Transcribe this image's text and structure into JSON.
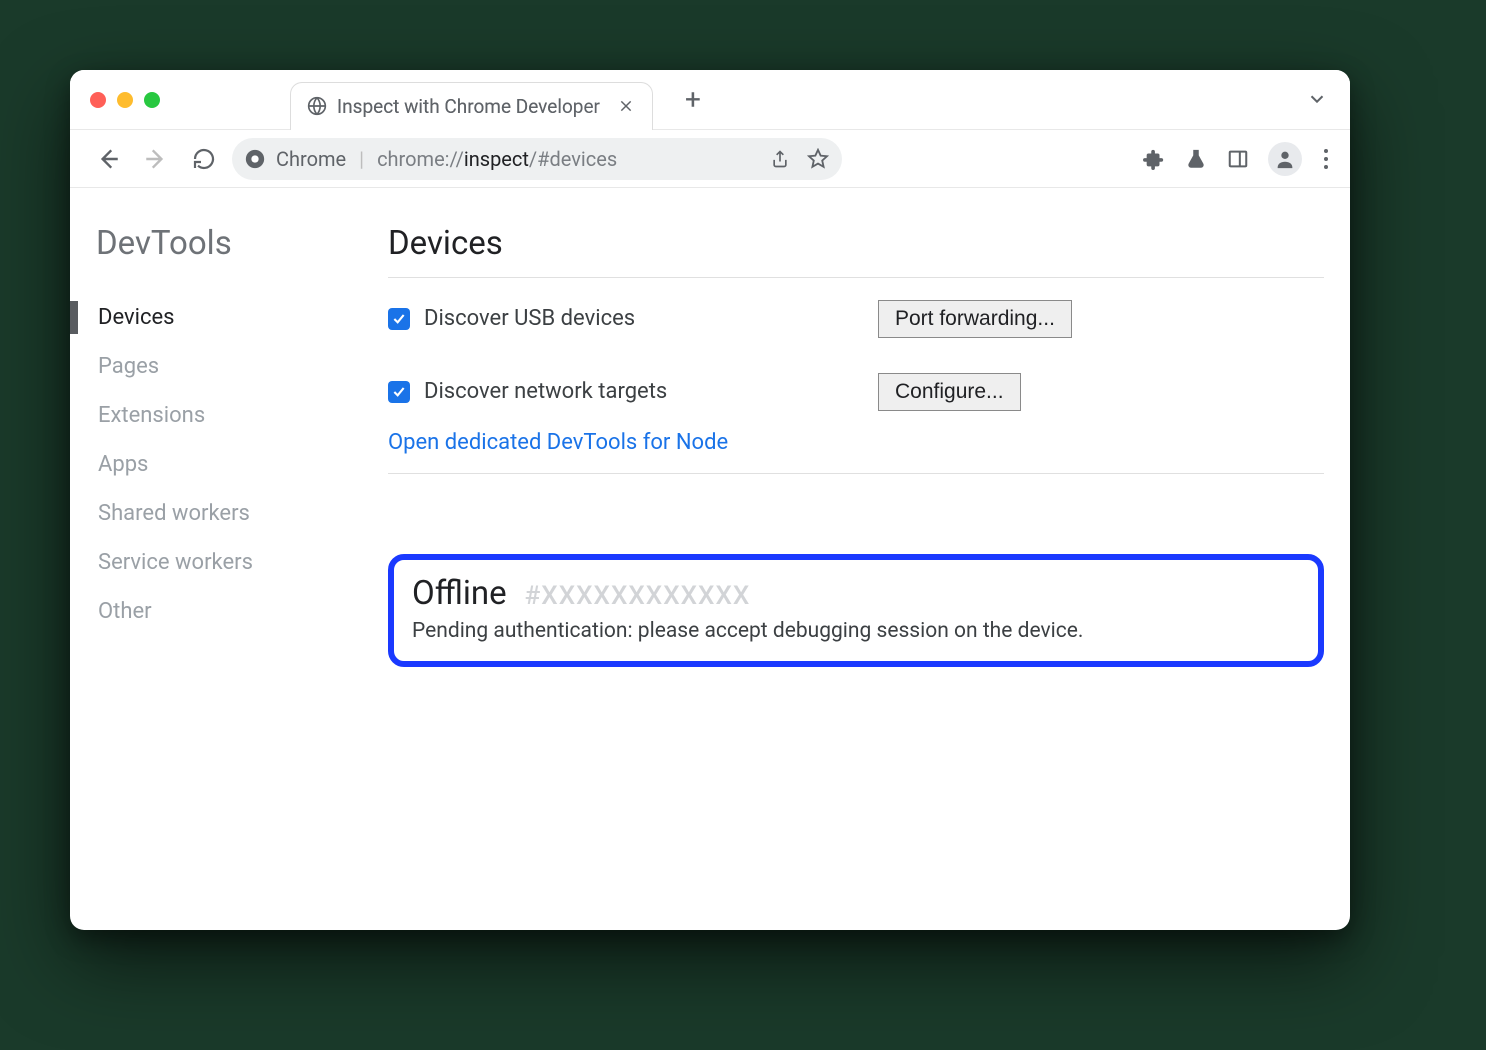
{
  "tab": {
    "title": "Inspect with Chrome Developer"
  },
  "omnibox": {
    "label": "Chrome",
    "url_prefix": "chrome://",
    "url_main": "inspect",
    "url_suffix": "/#devices"
  },
  "sidebar": {
    "title": "DevTools",
    "items": [
      {
        "label": "Devices",
        "active": true
      },
      {
        "label": "Pages",
        "active": false
      },
      {
        "label": "Extensions",
        "active": false
      },
      {
        "label": "Apps",
        "active": false
      },
      {
        "label": "Shared workers",
        "active": false
      },
      {
        "label": "Service workers",
        "active": false
      },
      {
        "label": "Other",
        "active": false
      }
    ]
  },
  "main": {
    "title": "Devices",
    "discover_usb_label": "Discover USB devices",
    "port_forwarding_btn": "Port forwarding...",
    "discover_network_label": "Discover network targets",
    "configure_btn": "Configure...",
    "node_link": "Open dedicated DevTools for Node",
    "offline": {
      "title": "Offline",
      "hash": "#XXXXXXXXXXXX",
      "message": "Pending authentication: please accept debugging session on the device."
    }
  }
}
